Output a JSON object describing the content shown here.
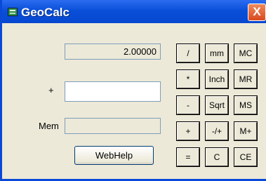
{
  "window": {
    "title": "GeoCalc",
    "close_glyph": "X"
  },
  "display": {
    "value": "2.00000"
  },
  "entry": {
    "value": ""
  },
  "memory": {
    "label": "Mem",
    "value": ""
  },
  "operation": {
    "symbol": "+"
  },
  "webhelp": {
    "label": "WebHelp"
  },
  "keypad": [
    [
      "/",
      "mm",
      "MC"
    ],
    [
      "*",
      "Inch",
      "MR"
    ],
    [
      "-",
      "Sqrt",
      "MS"
    ],
    [
      "+",
      "-/+",
      "M+"
    ],
    [
      "=",
      "C",
      "CE"
    ]
  ],
  "colors": {
    "titlebar": "#0a4fd9",
    "window_bg": "#ece9d8",
    "close_button": "#d84a1e"
  }
}
